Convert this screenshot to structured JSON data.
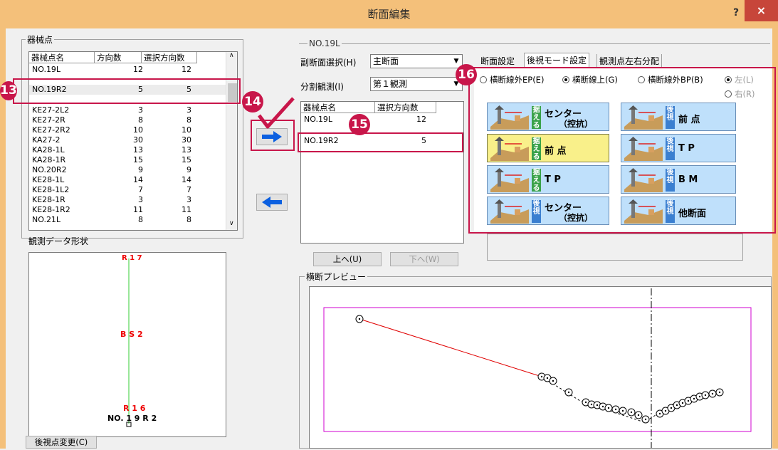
{
  "window": {
    "title": "断面編集",
    "help": "?",
    "close": "×"
  },
  "left": {
    "group_label": "器械点",
    "columns": [
      "器械点名",
      "方向数",
      "選択方向数"
    ],
    "rows": [
      {
        "name": "NO.19L",
        "dir": "12",
        "sel": "12"
      },
      {
        "name": "NO.19R2",
        "dir": "5",
        "sel": "5"
      },
      {
        "name": "KE27-2L2",
        "dir": "3",
        "sel": "3"
      },
      {
        "name": "KE27-2R",
        "dir": "8",
        "sel": "8"
      },
      {
        "name": "KE27-2R2",
        "dir": "10",
        "sel": "10"
      },
      {
        "name": "KA27-2",
        "dir": "30",
        "sel": "30"
      },
      {
        "name": "KA28-1L",
        "dir": "13",
        "sel": "13"
      },
      {
        "name": "KA28-1R",
        "dir": "15",
        "sel": "15"
      },
      {
        "name": "NO.20R2",
        "dir": "9",
        "sel": "9"
      },
      {
        "name": "KE28-1L",
        "dir": "14",
        "sel": "14"
      },
      {
        "name": "KE28-1L2",
        "dir": "7",
        "sel": "7"
      },
      {
        "name": "KE28-1R",
        "dir": "3",
        "sel": "3"
      },
      {
        "name": "KE28-1R2",
        "dir": "11",
        "sel": "11"
      },
      {
        "name": "NO.21L",
        "dir": "8",
        "sel": "8"
      }
    ],
    "shape_label": "観測データ形状",
    "shape_top_label": "R 1 7",
    "shape_mid_label": "B S 2",
    "shape_bot_label1": "R 1 6",
    "shape_bot_label2": "NO. 1 9 R 2",
    "back_btn": "後視点変更(C)"
  },
  "badges": {
    "b13": "13",
    "b14": "14",
    "b15": "15",
    "b16": "16"
  },
  "mid": {
    "section_label": "NO.19L",
    "sub_label": "副断面選択(H)",
    "sub_value": "主断面",
    "split_label": "分割観測(I)",
    "split_value": "第１観測",
    "columns": [
      "器械点名",
      "選択方向数"
    ],
    "rows": [
      {
        "name": "NO.19L",
        "sel": "12"
      },
      {
        "name": "NO.19R2",
        "sel": "5"
      }
    ],
    "up_btn": "上へ(U)",
    "down_btn": "下へ(W)",
    "preview_label": "横断プレビュー"
  },
  "right": {
    "tabs": [
      "断面設定",
      "後視モード設定",
      "観測点左右分配"
    ],
    "radios": [
      "横断線外EP(E)",
      "横断線上(G)",
      "横断線外BP(B)",
      "左(L)",
      "右(R)"
    ],
    "modes": [
      {
        "chip": "据える",
        "label1": "センター",
        "label2": "（控抗）"
      },
      {
        "chip": "後視",
        "label1": "前 点",
        "label2": ""
      },
      {
        "chip": "据える",
        "label1": "前 点",
        "label2": ""
      },
      {
        "chip": "後視",
        "label1": "T P",
        "label2": ""
      },
      {
        "chip": "据える",
        "label1": "T P",
        "label2": ""
      },
      {
        "chip": "後視",
        "label1": "B M",
        "label2": ""
      },
      {
        "chip": "後視",
        "label1": "センター",
        "label2": "（控抗）"
      },
      {
        "chip": "後視",
        "label1": "他断面",
        "label2": ""
      }
    ]
  },
  "colors": {
    "accent": "#c8164a",
    "title_bar": "#f4c07a",
    "mode_bg": "#bfe0fb",
    "mode_selected": "#f9f08a",
    "preview_frame": "#d000d0",
    "profile_line": "#e00000"
  }
}
